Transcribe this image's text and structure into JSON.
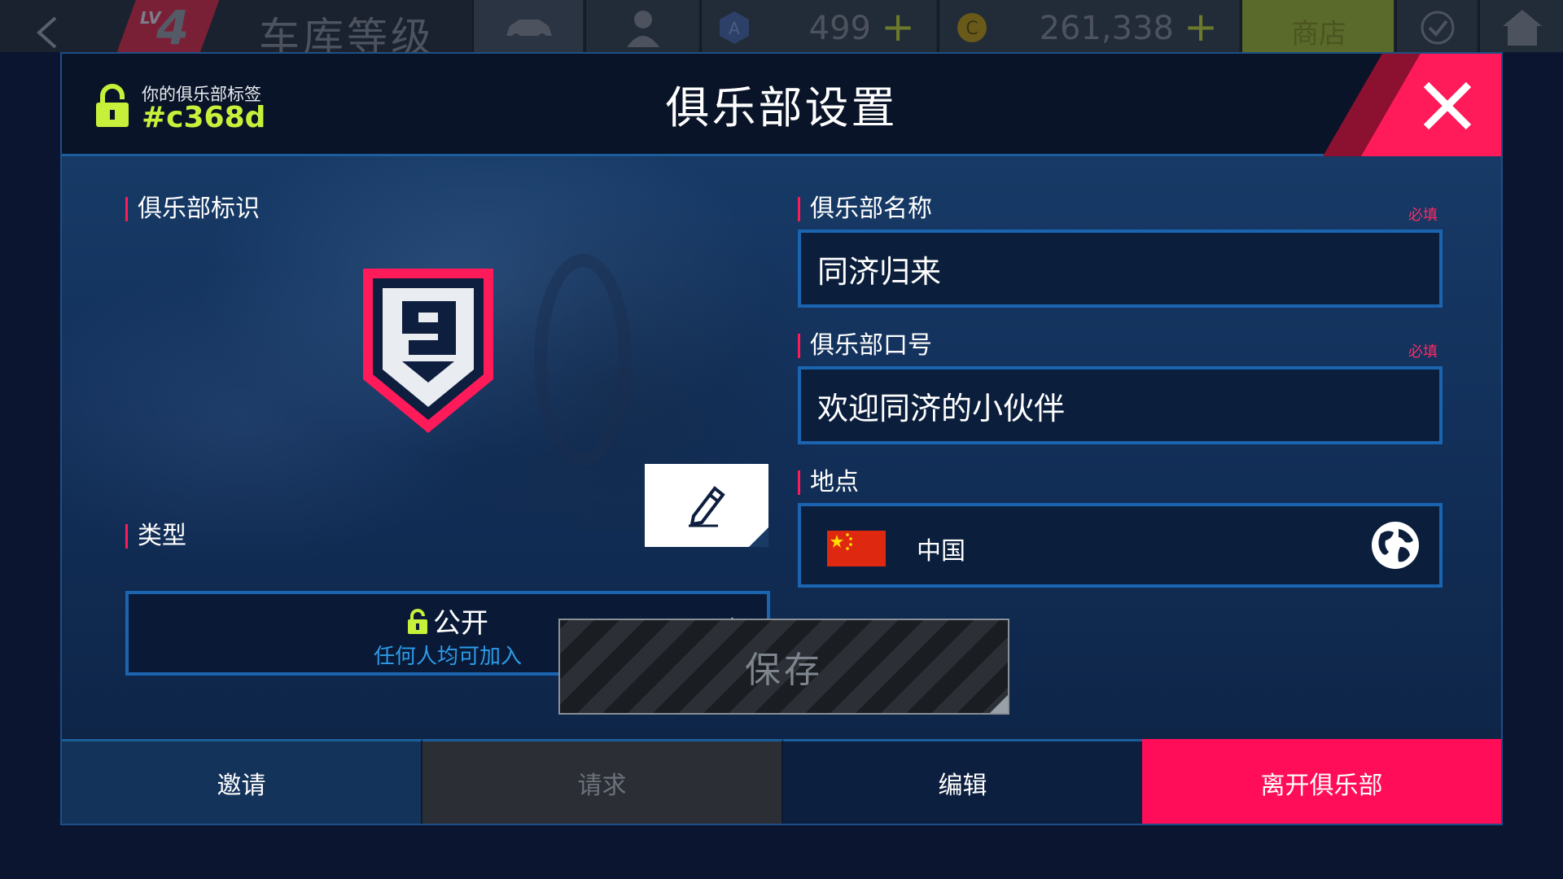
{
  "background_topbar": {
    "level_prefix": "LV",
    "level_number": "4",
    "garage_title": "车库等级",
    "gem_value": "499",
    "coin_value": "261,338",
    "plus": "+",
    "shop_label": "商店"
  },
  "modal": {
    "title": "俱乐部设置",
    "tag_caption": "你的俱乐部标签",
    "tag_value": "#c368d",
    "sections": {
      "emblem": "俱乐部标识",
      "name": "俱乐部名称",
      "motto": "俱乐部口号",
      "type": "类型",
      "location": "地点"
    },
    "required_label": "必填",
    "name_value": "同济归来",
    "motto_value": "欢迎同济的小伙伴",
    "type_value": "公开",
    "type_desc": "任何人均可加入",
    "location_value": "中国",
    "save_label": "保存",
    "tabs": {
      "invite": "邀请",
      "requests": "请求",
      "edit": "编辑",
      "leave": "离开俱乐部"
    }
  },
  "colors": {
    "accent_pink": "#ff0d58",
    "tag_green": "#c7f03b",
    "field_border": "#1b64b0",
    "type_desc_blue": "#2c9be8"
  },
  "icons": [
    "back-arrow-icon",
    "lock-icon",
    "close-icon",
    "pencil-icon",
    "chevron-right-icon",
    "globe-icon",
    "china-flag-icon",
    "club-emblem-icon"
  ]
}
